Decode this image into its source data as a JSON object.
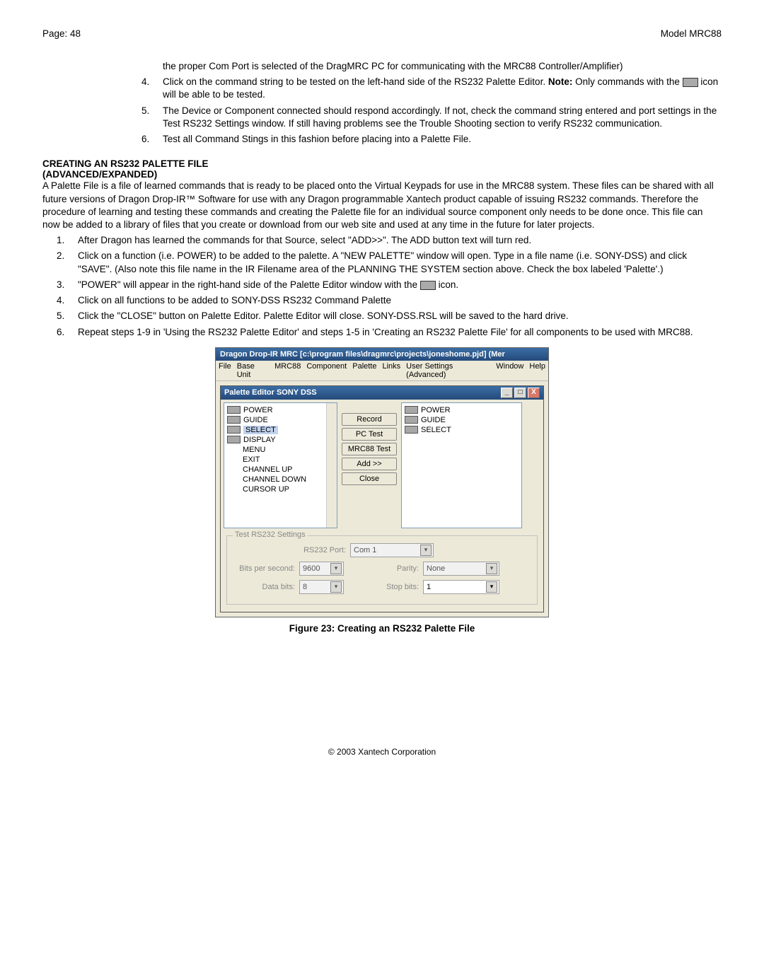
{
  "page_header_left": "Page: 48",
  "page_header_right": "Model MRC88",
  "top_list": [
    {
      "num": "",
      "txt_a": "the proper Com Port is selected of the DragMRC PC for communicating with the MRC88 Controller/Amplifier)"
    },
    {
      "num": "4.",
      "txt_a": "Click on the command string to be tested on the left-hand side of the RS232 Palette Editor. ",
      "note": "Note:",
      "txt_b": " Only commands with the ",
      "has_icon": true,
      "txt_c": " icon will be able to be tested."
    },
    {
      "num": "5.",
      "txt_a": "The Device or Component connected should respond accordingly. If not, check the command string entered and port settings in the Test RS232 Settings window. If still having problems see the Trouble Shooting section to verify RS232 communication."
    },
    {
      "num": "6.",
      "txt_a": "Test all Command Stings in this fashion before placing into a Palette File."
    }
  ],
  "heading1": "CREATING AN RS232 PALETTE FILE",
  "heading2": "(ADVANCED/EXPANDED)",
  "para1": "A Palette File is a file of learned commands that is ready to be placed onto the Virtual Keypads for use in the MRC88 system. These files can be shared with all future versions of Dragon Drop-IR™ Software for use with any Dragon programmable Xantech product capable of issuing RS232 commands. Therefore the procedure of learning and testing these commands and creating the Palette file for an individual source component only needs to be done once. This file can now be added to a library of files that you create or download from our web site and used at any time in the future for later projects.",
  "steps": [
    {
      "num": "1.",
      "txt_a": "After Dragon has learned the commands for that Source, select \"ADD>>\". The ADD button text will turn red."
    },
    {
      "num": "2.",
      "txt_a": "Click on a function (i.e. POWER) to be added to the palette. A \"NEW PALETTE\" window will open. Type in a file name (i.e. SONY-DSS) and click \"SAVE\". (Also note this file name in the IR Filename area of the PLANNING THE SYSTEM section above. Check the box labeled 'Palette'.)"
    },
    {
      "num": "3.",
      "txt_a": "\"POWER\" will appear in the right-hand side of the Palette Editor window with the ",
      "has_icon": true,
      "txt_c": " icon."
    },
    {
      "num": "4.",
      "txt_a": "Click on all functions to be added to SONY-DSS RS232 Command Palette"
    },
    {
      "num": "5.",
      "txt_a": "Click the \"CLOSE\" button on Palette Editor. Palette Editor will close. SONY-DSS.RSL will be saved to the hard drive."
    },
    {
      "num": "6.",
      "txt_a": "Repeat steps 1-9 in 'Using the RS232 Palette Editor' and steps 1-5 in 'Creating an RS232 Palette File' for all components to be used with MRC88."
    }
  ],
  "window": {
    "title": "Dragon Drop-IR MRC [c:\\program files\\dragmrc\\projects\\joneshome.pjd] (Mer",
    "menus": [
      "File",
      "Base Unit",
      "MRC88",
      "Component",
      "Palette",
      "Links",
      "User Settings (Advanced)",
      "Window",
      "Help"
    ],
    "subtitle": "Palette Editor SONY DSS",
    "winbtn_min": "_",
    "winbtn_max": "□",
    "winbtn_close": "X",
    "left_items": [
      {
        "icon": true,
        "label": "POWER",
        "sel": false
      },
      {
        "icon": true,
        "label": "GUIDE",
        "sel": false
      },
      {
        "icon": true,
        "label": "SELECT",
        "sel": true
      },
      {
        "icon": true,
        "label": "DISPLAY",
        "sel": false
      },
      {
        "icon": false,
        "label": "MENU",
        "sel": false
      },
      {
        "icon": false,
        "label": "EXIT",
        "sel": false
      },
      {
        "icon": false,
        "label": "CHANNEL UP",
        "sel": false
      },
      {
        "icon": false,
        "label": "CHANNEL DOWN",
        "sel": false
      },
      {
        "icon": false,
        "label": "CURSOR UP",
        "sel": false
      }
    ],
    "buttons": [
      "Record",
      "PC Test",
      "MRC88 Test",
      "Add >>",
      "Close"
    ],
    "right_items": [
      {
        "icon": true,
        "label": "POWER"
      },
      {
        "icon": true,
        "label": "GUIDE"
      },
      {
        "icon": true,
        "label": "SELECT"
      }
    ],
    "group_title": "Test RS232 Settings",
    "rs232port_label": "RS232 Port:",
    "rs232port_val": "Com 1",
    "bps_label": "Bits per second:",
    "bps_val": "9600",
    "parity_label": "Parity:",
    "parity_val": "None",
    "databits_label": "Data bits:",
    "databits_val": "8",
    "stopbits_label": "Stop bits:",
    "stopbits_val": "1"
  },
  "figure_caption": "Figure 23: Creating an RS232 Palette File",
  "footer": "© 2003 Xantech Corporation"
}
